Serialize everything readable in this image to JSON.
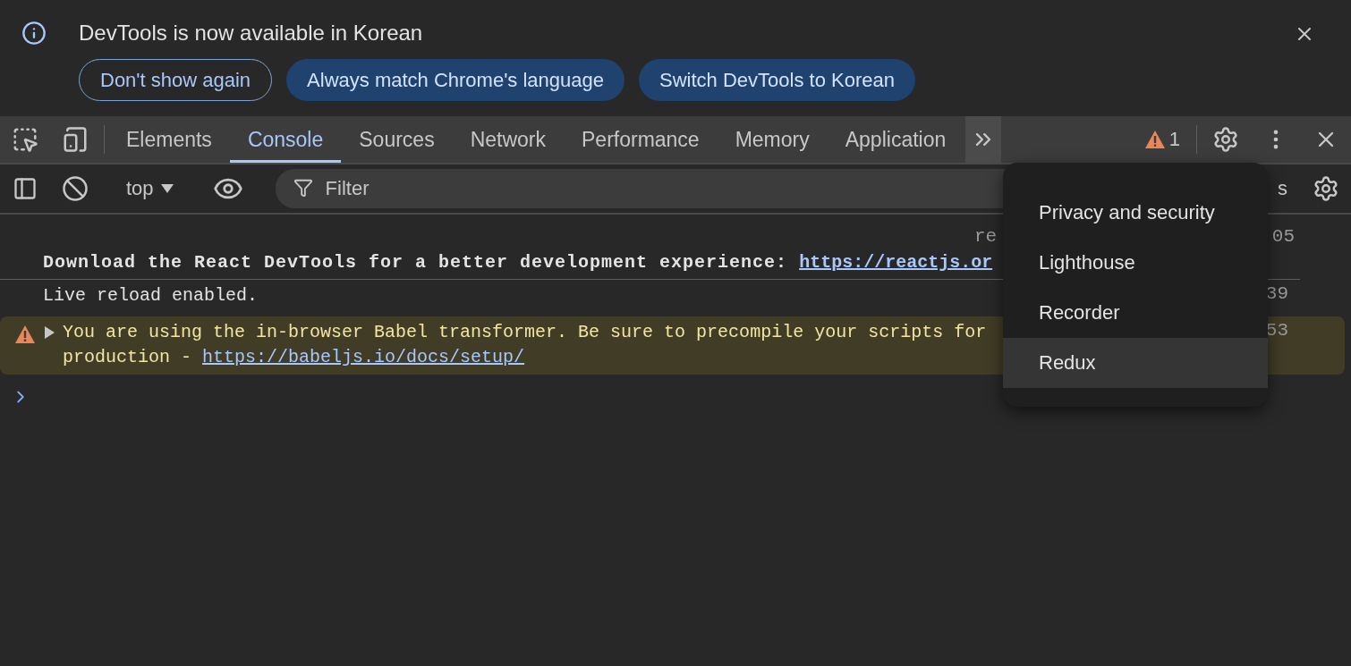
{
  "infobar": {
    "message": "DevTools is now available in Korean",
    "buttons": [
      {
        "label": "Don't show again",
        "kind": "outlined"
      },
      {
        "label": "Always match Chrome's language",
        "kind": "filled"
      },
      {
        "label": "Switch DevTools to Korean",
        "kind": "filled"
      }
    ]
  },
  "tabs": [
    {
      "label": "Elements",
      "selected": false
    },
    {
      "label": "Console",
      "selected": true
    },
    {
      "label": "Sources",
      "selected": false
    },
    {
      "label": "Network",
      "selected": false
    },
    {
      "label": "Performance",
      "selected": false
    },
    {
      "label": "Memory",
      "selected": false
    },
    {
      "label": "Application",
      "selected": false
    }
  ],
  "issues": {
    "count": "1"
  },
  "console_toolbar": {
    "context": "top",
    "filter_placeholder": "Filter",
    "levels_tail": "s"
  },
  "messages": [
    {
      "kind": "log",
      "bold": true,
      "text": "Download the React DevTools for a better development experience: ",
      "link": "https://reactjs.or",
      "source_start": "re",
      "source_end": "05",
      "divider_below": true
    },
    {
      "kind": "log",
      "bold": false,
      "text": "Live reload enabled.",
      "source_end": "39",
      "divider_below": false
    },
    {
      "kind": "warning",
      "bold": false,
      "expanded": false,
      "text": "You are using the in-browser Babel transformer. Be sure to precompile your scripts for production - ",
      "link": "https://babeljs.io/docs/setup/",
      "source_end": "53",
      "divider_below": false
    }
  ],
  "more_tabs_menu": {
    "items": [
      {
        "label": "Privacy and security",
        "highlighted": false
      },
      {
        "label": "Lighthouse",
        "highlighted": false
      },
      {
        "label": "Recorder",
        "highlighted": false
      },
      {
        "label": "Redux",
        "highlighted": true
      }
    ]
  }
}
